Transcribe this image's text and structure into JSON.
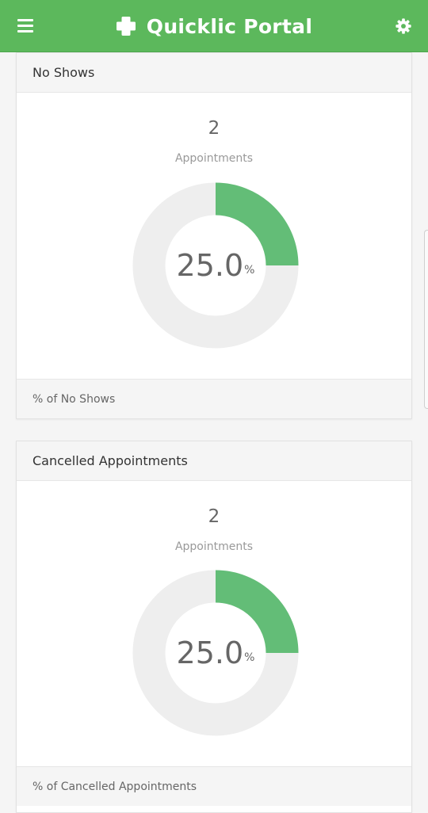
{
  "app": {
    "title": "Quicklic Portal",
    "brand_color": "#5cb85c",
    "icons": {
      "menu": "hamburger-menu-icon",
      "logo": "medical-cross-icon",
      "settings": "gear-icon"
    }
  },
  "cards": [
    {
      "title": "No Shows",
      "count": "2",
      "count_label": "Appointments",
      "percent_text": "25.0",
      "percent_unit": "%",
      "footer": "% of No Shows",
      "fill_fraction": 0.25,
      "fill_color": "#63bd77",
      "track_color": "#eeeeee"
    },
    {
      "title": "Cancelled Appointments",
      "count": "2",
      "count_label": "Appointments",
      "percent_text": "25.0",
      "percent_unit": "%",
      "footer": "% of Cancelled Appointments",
      "fill_fraction": 0.25,
      "fill_color": "#63bd77",
      "track_color": "#eeeeee"
    }
  ]
}
